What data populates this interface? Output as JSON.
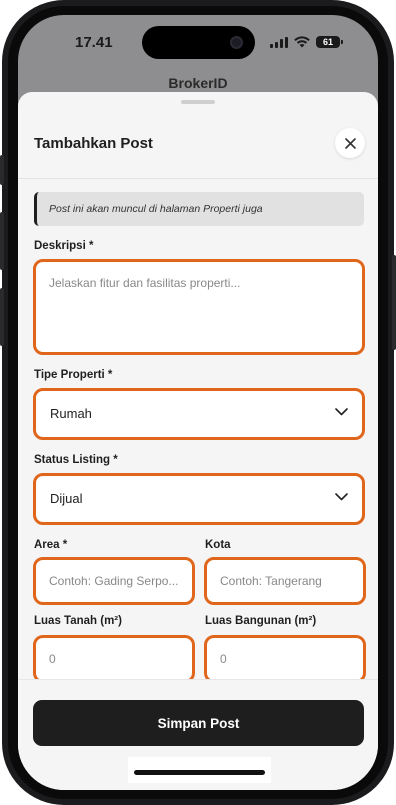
{
  "status_bar": {
    "time": "17.41",
    "battery": "61"
  },
  "app": {
    "title": "BrokerID"
  },
  "sheet": {
    "title": "Tambahkan Post",
    "notice": "Post ini akan muncul di halaman Properti juga"
  },
  "form": {
    "deskripsi": {
      "label": "Deskripsi *",
      "placeholder": "Jelaskan fitur dan fasilitas properti..."
    },
    "tipe_properti": {
      "label": "Tipe Properti *",
      "value": "Rumah"
    },
    "status_listing": {
      "label": "Status Listing *",
      "value": "Dijual"
    },
    "area": {
      "label": "Area *",
      "placeholder": "Contoh: Gading Serpo..."
    },
    "kota": {
      "label": "Kota",
      "placeholder": "Contoh: Tangerang"
    },
    "luas_tanah": {
      "label": "Luas Tanah (m²)",
      "value": "0"
    },
    "luas_bangunan": {
      "label": "Luas Bangunan (m²)",
      "value": "0"
    }
  },
  "actions": {
    "save_label": "Simpan Post"
  },
  "icons": {
    "close": "close-icon",
    "chevron": "chevron-down-icon",
    "signal": "cellular-signal-icon",
    "wifi": "wifi-icon",
    "battery": "battery-icon"
  },
  "colors": {
    "field_border": "#e0661b",
    "button": "#1e1e1e",
    "sheet_bg": "#f5f5f5"
  }
}
